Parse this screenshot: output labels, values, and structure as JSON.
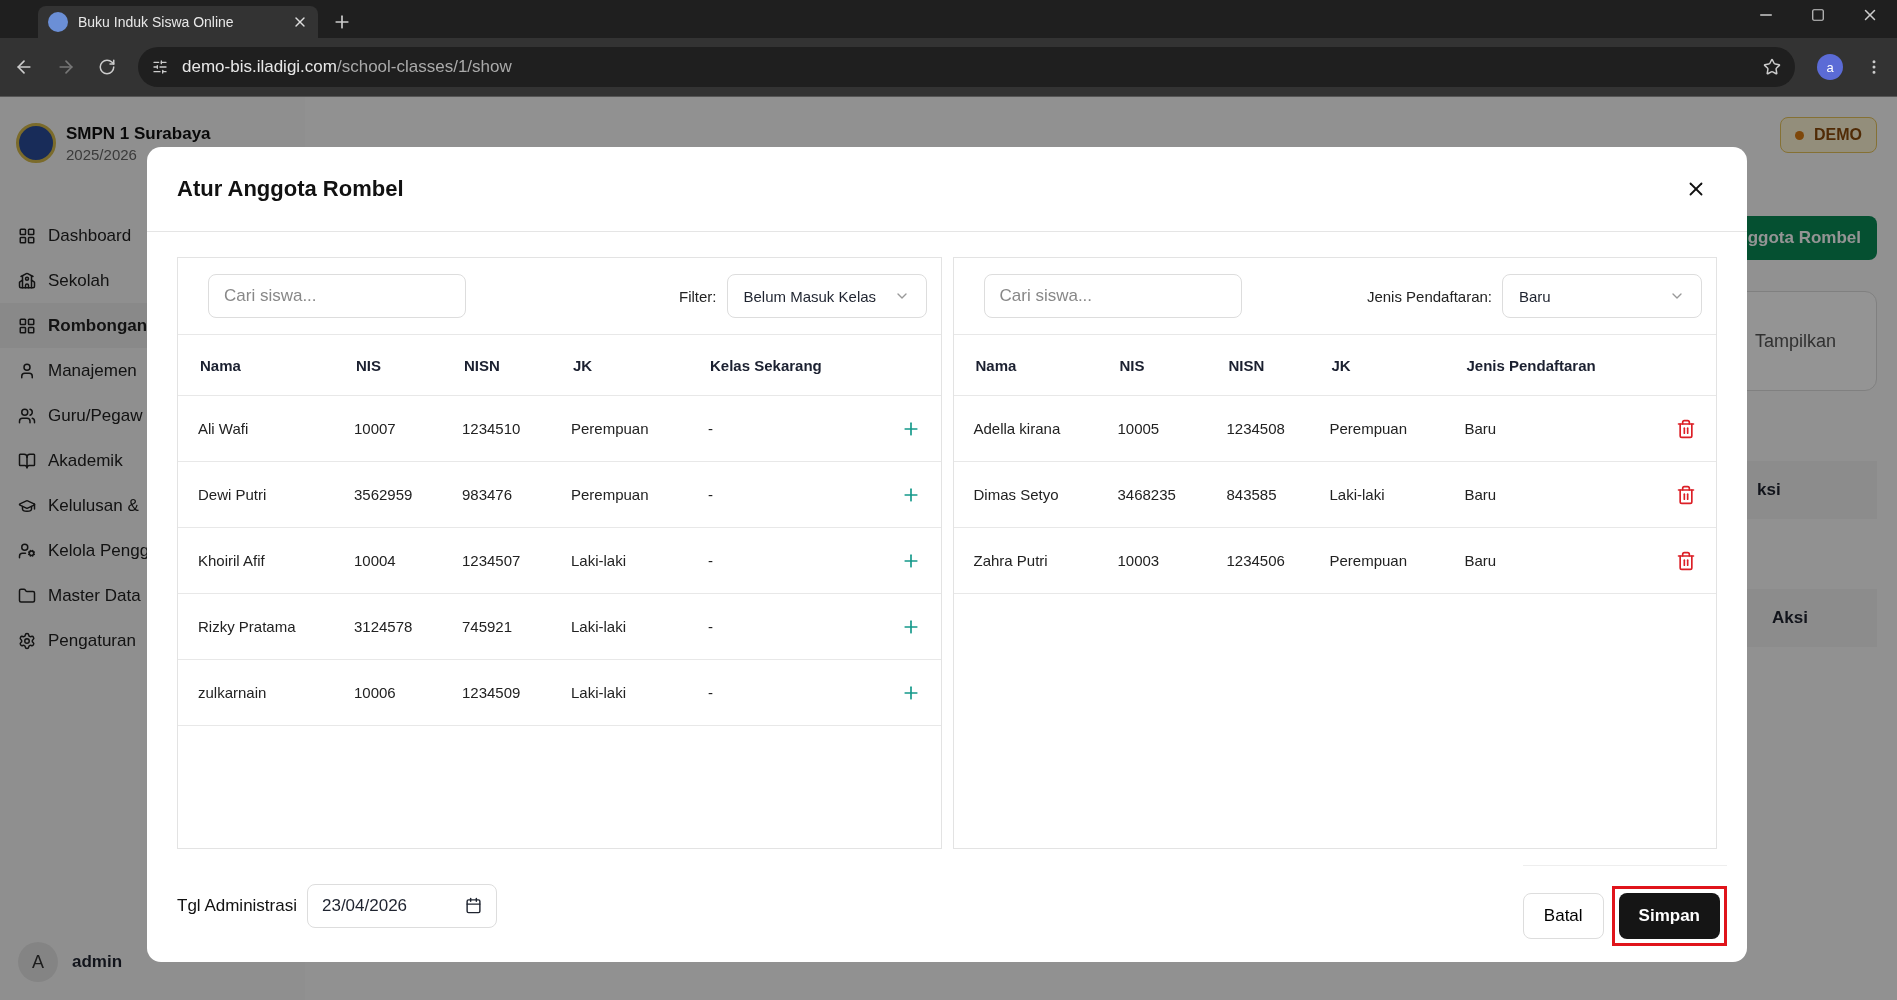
{
  "browser": {
    "tab_title": "Buku Induk Siswa Online",
    "url_host": "demo-bis.iladigi.com",
    "url_path": "/school-classes/1/show",
    "profile": "a"
  },
  "sidebar": {
    "school_name": "SMPN 1 Surabaya",
    "year": "2025/2026",
    "items": [
      {
        "label": "Dashboard",
        "selected": false
      },
      {
        "label": "Sekolah",
        "selected": false
      },
      {
        "label": "Rombongan",
        "selected": true
      },
      {
        "label": "Manajemen",
        "selected": false
      },
      {
        "label": "Guru/Pegaw",
        "selected": false
      },
      {
        "label": "Akademik",
        "selected": false
      },
      {
        "label": "Kelulusan &",
        "selected": false
      },
      {
        "label": "Kelola Pengg",
        "selected": false
      },
      {
        "label": "Master Data",
        "selected": false
      },
      {
        "label": "Pengaturan",
        "selected": false
      }
    ],
    "user": {
      "avatar": "A",
      "name": "admin"
    }
  },
  "page": {
    "demo_badge": "DEMO",
    "add_button": "ggota Rombel",
    "card_label": "Tampilkan",
    "table_header_1": "ksi",
    "table_header_2": "Aksi"
  },
  "modal": {
    "title": "Atur Anggota Rombel",
    "left": {
      "search_placeholder": "Cari siswa...",
      "filter_label": "Filter:",
      "filter_value": "Belum Masuk Kelas",
      "columns": [
        "Nama",
        "NIS",
        "NISN",
        "JK",
        "Kelas Sekarang"
      ],
      "rows": [
        {
          "nama": "Ali Wafi",
          "nis": "10007",
          "nisn": "1234510",
          "jk": "Perempuan",
          "kelas": "-"
        },
        {
          "nama": "Dewi Putri",
          "nis": "3562959",
          "nisn": "983476",
          "jk": "Perempuan",
          "kelas": "-"
        },
        {
          "nama": "Khoiril Afif",
          "nis": "10004",
          "nisn": "1234507",
          "jk": "Laki-laki",
          "kelas": "-"
        },
        {
          "nama": "Rizky Pratama",
          "nis": "3124578",
          "nisn": "745921",
          "jk": "Laki-laki",
          "kelas": "-"
        },
        {
          "nama": "zulkarnain",
          "nis": "10006",
          "nisn": "1234509",
          "jk": "Laki-laki",
          "kelas": "-"
        }
      ]
    },
    "right": {
      "search_placeholder": "Cari siswa...",
      "filter_label": "Jenis Pendaftaran:",
      "filter_value": "Baru",
      "columns": [
        "Nama",
        "NIS",
        "NISN",
        "JK",
        "Jenis Pendaftaran"
      ],
      "rows": [
        {
          "nama": "Adella kirana",
          "nis": "10005",
          "nisn": "1234508",
          "jk": "Perempuan",
          "jenis": "Baru"
        },
        {
          "nama": "Dimas Setyo",
          "nis": "3468235",
          "nisn": "843585",
          "jk": "Laki-laki",
          "jenis": "Baru"
        },
        {
          "nama": "Zahra Putri",
          "nis": "10003",
          "nisn": "1234506",
          "jk": "Perempuan",
          "jenis": "Baru"
        }
      ]
    },
    "footer": {
      "date_label": "Tgl Administrasi",
      "date_value": "23/04/2026",
      "cancel": "Batal",
      "save": "Simpan",
      "save_highlighted": true
    }
  }
}
